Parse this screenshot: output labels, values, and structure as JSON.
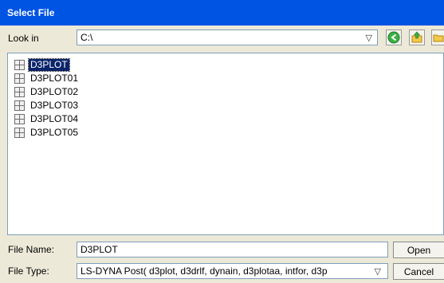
{
  "window": {
    "title": "Select File"
  },
  "lookin": {
    "label": "Look in",
    "value": "C:\\",
    "dropdown_icon": "chevron-down-icon",
    "back_icon": "back-arrow-icon",
    "up_icon": "up-folder-icon",
    "newfolder_icon": "new-folder-icon"
  },
  "files": [
    {
      "name": "D3PLOT",
      "selected": true
    },
    {
      "name": "D3PLOT01",
      "selected": false
    },
    {
      "name": "D3PLOT02",
      "selected": false
    },
    {
      "name": "D3PLOT03",
      "selected": false
    },
    {
      "name": "D3PLOT04",
      "selected": false
    },
    {
      "name": "D3PLOT05",
      "selected": false
    }
  ],
  "filename": {
    "label": "File Name:",
    "value": "D3PLOT"
  },
  "filetype": {
    "label": "File Type:",
    "value": "LS-DYNA Post( d3plot, d3drlf, dynain, d3plotaa, intfor, d3p"
  },
  "buttons": {
    "open": "Open",
    "cancel": "Cancel"
  },
  "colors": {
    "titlebar": "#0054e3",
    "selection": "#0a246a",
    "dialog_bg": "#ece9d8"
  }
}
